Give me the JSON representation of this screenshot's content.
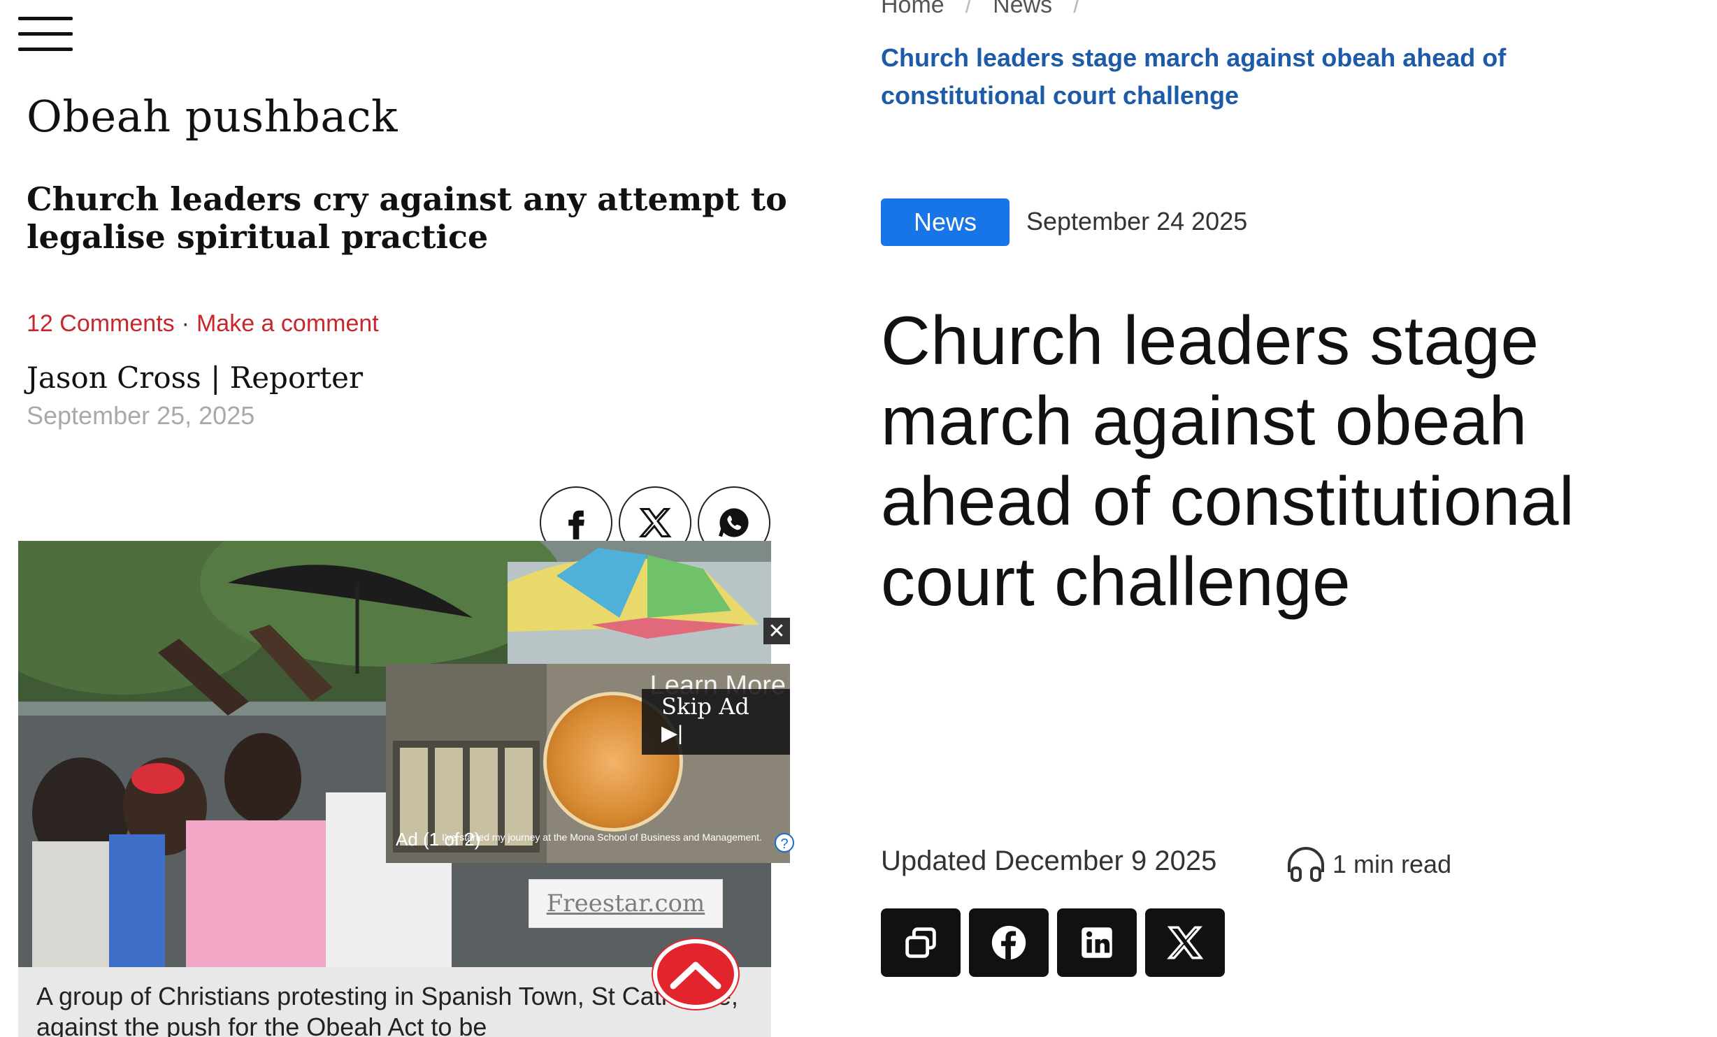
{
  "left": {
    "section_title": "Obeah pushback",
    "subheadline": "Church leaders cry against any attempt to legalise spiritual practice",
    "comments_link": "12 Comments",
    "separator": "·",
    "make_comment_link": "Make a comment",
    "byline": "Jason Cross | Reporter",
    "date": "September 25, 2025",
    "share_icons": [
      "facebook-icon",
      "x-icon",
      "whatsapp-icon"
    ],
    "ad": {
      "close": "✕",
      "learn_more": "Learn More",
      "skip_label": "Skip Ad",
      "skip_icon": "▶|",
      "ad_label": "Ad (1 of 2)",
      "ad_text": "I've started my journey at the Mona School of Business and Management.",
      "help": "?",
      "freestar": "Freestar.com"
    },
    "caption": "A group of Christians protesting in Spanish Town, St Catherine, against the push for the Obeah Act to be"
  },
  "right": {
    "breadcrumb": [
      "Home",
      "News"
    ],
    "breadcrumb_sep": "/",
    "breadcrumb_current": "Church leaders stage march against obeah ahead of constitutional court challenge",
    "category_badge": "News",
    "badge_date": "September 24 2025",
    "headline": "Church leaders stage march against obeah ahead of constitutional court challenge",
    "updated": "Updated December 9 2025",
    "read_time": "1 min read",
    "share_buttons": [
      "copy-icon",
      "facebook-icon",
      "linkedin-icon",
      "x-icon"
    ]
  },
  "colors": {
    "comment_red": "#c8262b",
    "breadcrumb_blue": "#1d5aa8",
    "badge_blue": "#1775e8",
    "scroll_top_red": "#e2242d"
  }
}
